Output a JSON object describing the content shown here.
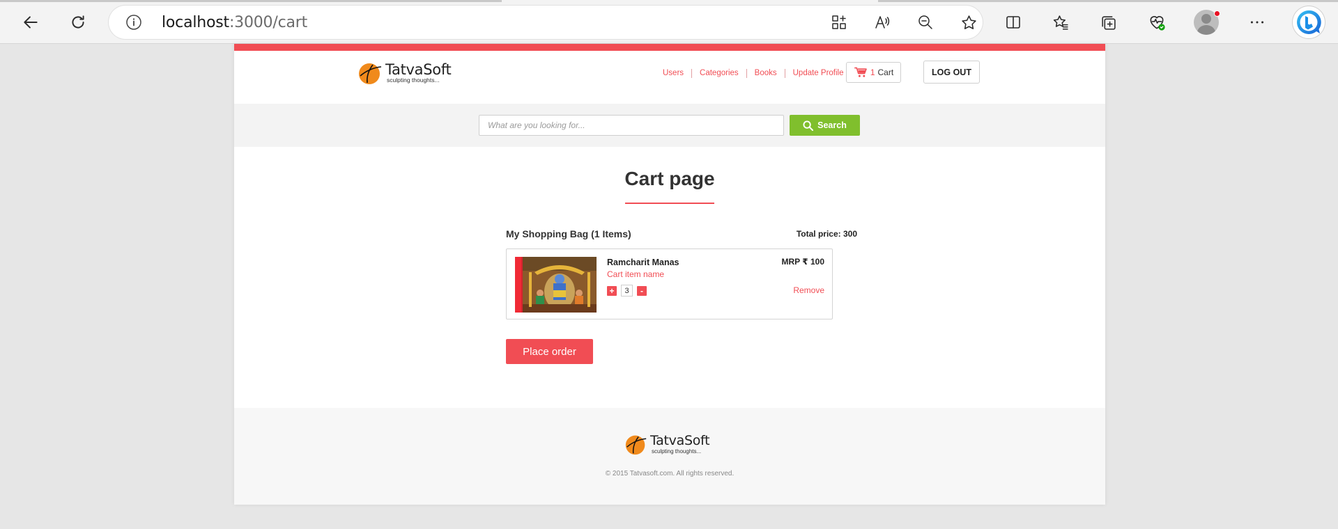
{
  "browser": {
    "url_host": "localhost",
    "url_path": ":3000/cart"
  },
  "header": {
    "logo": {
      "name": "TatvaSoft",
      "tagline": "sculpting thoughts..."
    },
    "nav": [
      {
        "label": "Users"
      },
      {
        "label": "Categories"
      },
      {
        "label": "Books"
      },
      {
        "label": "Update Profile"
      }
    ],
    "cart": {
      "count": "1",
      "label": "Cart"
    },
    "logout_label": "LOG OUT"
  },
  "search": {
    "placeholder": "What are you looking for...",
    "button_label": "Search"
  },
  "main": {
    "title": "Cart page",
    "bag_heading": "My Shopping Bag (1 Items)",
    "total_price": "Total price: 300",
    "items": [
      {
        "name": "Ramcharit Manas",
        "subtitle": "Cart item name",
        "mrp": "MRP ₹ 100",
        "quantity": "3",
        "plus": "+",
        "minus": "-",
        "remove_label": "Remove"
      }
    ],
    "place_order_label": "Place order"
  },
  "footer": {
    "logo": {
      "name": "TatvaSoft",
      "tagline": "sculpting thoughts..."
    },
    "copyright": "© 2015 Tatvasoft.com. All rights reserved."
  },
  "colors": {
    "accent": "#f14d54",
    "search_green": "#80bf2d",
    "logo_orange": "#f08a1c"
  },
  "icons": {
    "back": "arrow-left-icon",
    "refresh": "refresh-icon",
    "info": "info-icon",
    "apps": "add-app-icon",
    "read_aloud": "read-aloud-icon",
    "zoom": "zoom-out-icon",
    "favorite": "star-icon",
    "split": "split-screen-icon",
    "favorites": "favorites-icon",
    "collections": "collections-icon",
    "health": "browser-essentials-icon",
    "more": "more-icon",
    "bing": "bing-copilot-icon",
    "cart": "shopping-cart-icon",
    "search": "search-icon"
  }
}
